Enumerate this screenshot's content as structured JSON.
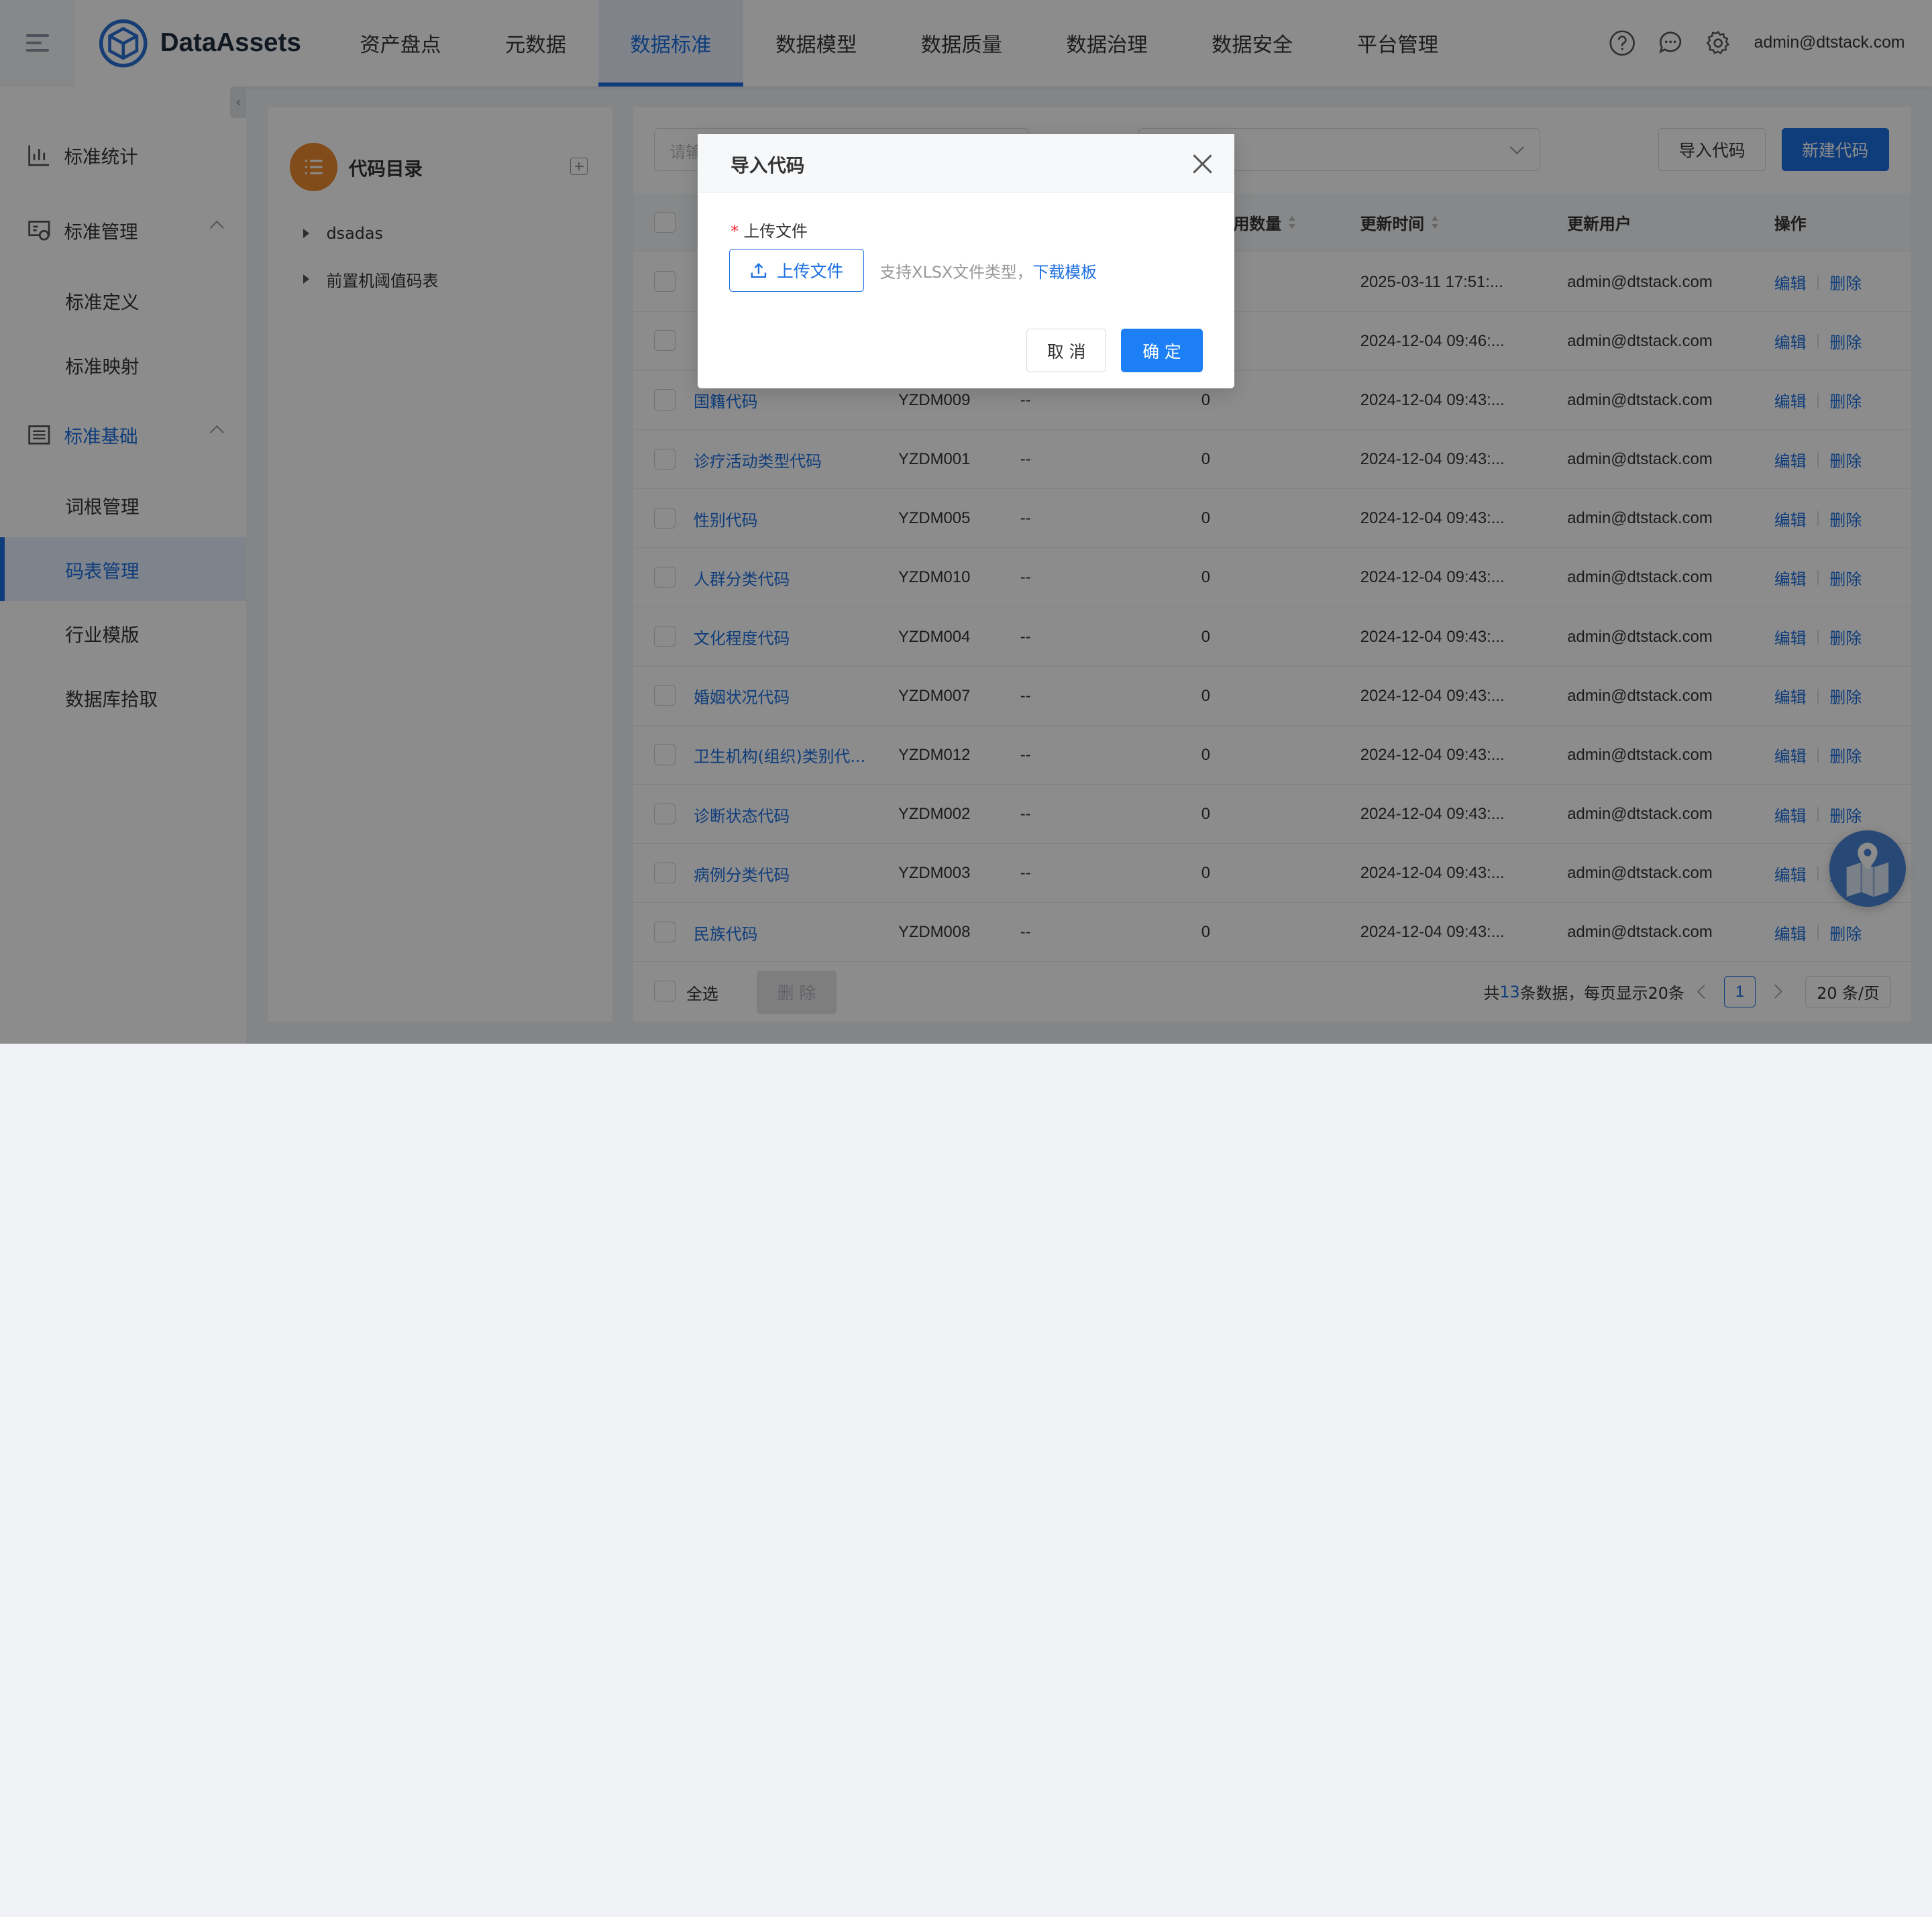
{
  "header": {
    "app_name": "DataAssets",
    "nav": [
      "资产盘点",
      "元数据",
      "数据标准",
      "数据模型",
      "数据质量",
      "数据治理",
      "数据安全",
      "平台管理"
    ],
    "active_nav": "数据标准",
    "user": "admin@dtstack.com",
    "icons": [
      "help-icon",
      "message-icon",
      "settings-icon"
    ]
  },
  "sidebar": {
    "group1": "标准统计",
    "group2": "标准管理",
    "group2_items": [
      "标准定义",
      "标准映射"
    ],
    "group3": "标准基础",
    "group3_items": [
      "词根管理",
      "码表管理",
      "行业模版",
      "数据库拾取"
    ],
    "active_item": "码表管理"
  },
  "tree": {
    "title": "代码目录",
    "nodes": [
      "dsadas",
      "前置机阈值码表"
    ]
  },
  "toolbar": {
    "search_placeholder": "请输",
    "import_label": "导入代码",
    "new_label": "新建代码"
  },
  "table": {
    "headers": [
      "用数量",
      "更新时间",
      "更新用户",
      "操作"
    ],
    "rows": [
      {
        "name": "",
        "code": "",
        "desc": "",
        "count": "",
        "time": "2025-03-11 17:51:...",
        "user": "admin@dtstack.com"
      },
      {
        "name": "",
        "code": "",
        "desc": "",
        "count": "",
        "time": "2024-12-04 09:46:...",
        "user": "admin@dtstack.com"
      },
      {
        "name": "国籍代码",
        "code": "YZDM009",
        "desc": "--",
        "count": "0",
        "time": "2024-12-04 09:43:...",
        "user": "admin@dtstack.com"
      },
      {
        "name": "诊疗活动类型代码",
        "code": "YZDM001",
        "desc": "--",
        "count": "0",
        "time": "2024-12-04 09:43:...",
        "user": "admin@dtstack.com"
      },
      {
        "name": "性别代码",
        "code": "YZDM005",
        "desc": "--",
        "count": "0",
        "time": "2024-12-04 09:43:...",
        "user": "admin@dtstack.com"
      },
      {
        "name": "人群分类代码",
        "code": "YZDM010",
        "desc": "--",
        "count": "0",
        "time": "2024-12-04 09:43:...",
        "user": "admin@dtstack.com"
      },
      {
        "name": "文化程度代码",
        "code": "YZDM004",
        "desc": "--",
        "count": "0",
        "time": "2024-12-04 09:43:...",
        "user": "admin@dtstack.com"
      },
      {
        "name": "婚姻状况代码",
        "code": "YZDM007",
        "desc": "--",
        "count": "0",
        "time": "2024-12-04 09:43:...",
        "user": "admin@dtstack.com"
      },
      {
        "name": "卫生机构(组织)类别代...",
        "code": "YZDM012",
        "desc": "--",
        "count": "0",
        "time": "2024-12-04 09:43:...",
        "user": "admin@dtstack.com"
      },
      {
        "name": "诊断状态代码",
        "code": "YZDM002",
        "desc": "--",
        "count": "0",
        "time": "2024-12-04 09:43:...",
        "user": "admin@dtstack.com"
      },
      {
        "name": "病例分类代码",
        "code": "YZDM003",
        "desc": "--",
        "count": "0",
        "time": "2024-12-04 09:43:...",
        "user": "admin@dtstack.com"
      },
      {
        "name": "民族代码",
        "code": "YZDM008",
        "desc": "--",
        "count": "0",
        "time": "2024-12-04 09:43:...",
        "user": "admin@dtstack.com"
      }
    ],
    "edit_label": "编辑",
    "delete_label": "删除"
  },
  "footer": {
    "select_all": "全选",
    "delete_label": "删 除",
    "total_prefix": "共",
    "total": "13",
    "total_suffix": "条数据，每页显示20条",
    "current_page": "1",
    "page_size": "20 条/页"
  },
  "modal": {
    "title": "导入代码",
    "required_mark": "*",
    "field_label": "上传文件",
    "upload_label": "上传文件",
    "hint": "支持XLSX文件类型，",
    "template_link": "下载模板",
    "cancel_label": "取 消",
    "ok_label": "确 定"
  },
  "colors": {
    "primary": "#1d6fe0",
    "accent_orange": "#ec8a2f"
  }
}
